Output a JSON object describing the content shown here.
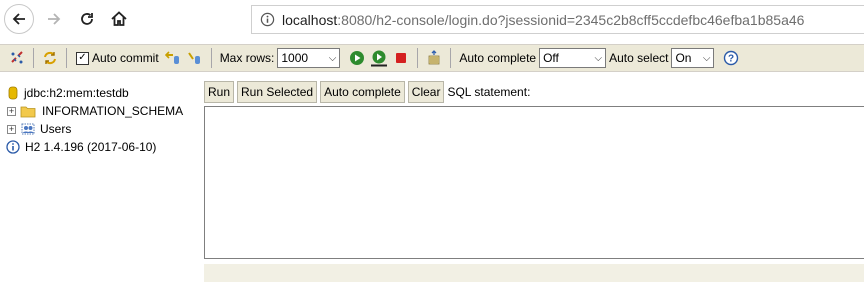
{
  "browser": {
    "url_host": "localhost",
    "url_rest": ":8080/h2-console/login.do?jsessionid=2345c2b8cff5ccdefbc46efba1b85a46"
  },
  "toolbar": {
    "auto_commit_label": "Auto commit",
    "auto_commit_checked": true,
    "max_rows_label": "Max rows:",
    "max_rows_value": "1000",
    "auto_complete_label": "Auto complete",
    "auto_complete_value": "Off",
    "auto_select_label": "Auto select",
    "auto_select_value": "On",
    "help_glyph": "?"
  },
  "tree": {
    "connection": "jdbc:h2:mem:testdb",
    "items": [
      {
        "label": "INFORMATION_SCHEMA",
        "icon": "folder-icon"
      },
      {
        "label": "Users",
        "icon": "users-icon"
      }
    ],
    "version": "H2 1.4.196 (2017-06-10)"
  },
  "editor": {
    "run_label": "Run",
    "run_selected_label": "Run Selected",
    "auto_complete_label": "Auto complete",
    "clear_label": "Clear",
    "sql_statement_label": "SQL statement:",
    "sql_text": ""
  }
}
